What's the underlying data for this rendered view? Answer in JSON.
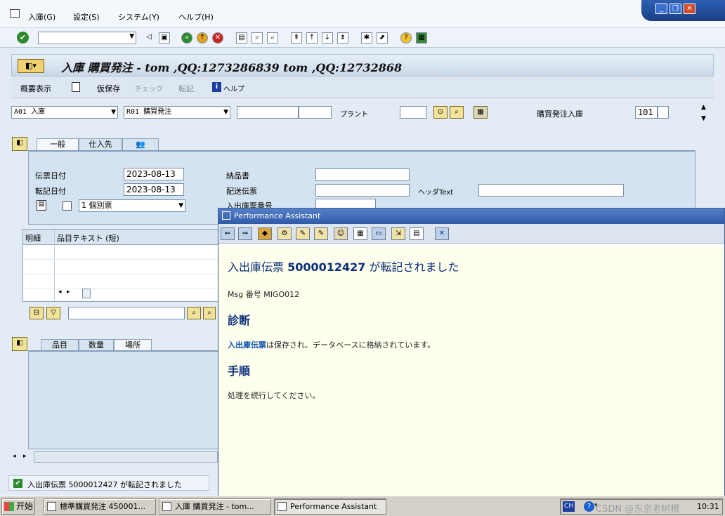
{
  "menu": {
    "items": [
      "入庫(G)",
      "設定(S)",
      "システム(Y)",
      "ヘルプ(H)"
    ]
  },
  "screen": {
    "title": "入庫 購買発注 - tom ,QQ:1273286839 tom ,QQ:12732868"
  },
  "appbar": {
    "overview": "概要表示",
    "hold": "仮保存",
    "check": "チェック",
    "post": "転記",
    "help": "ヘルプ"
  },
  "header": {
    "transaction": "A01 入庫",
    "reference": "R01 購買発注",
    "plant_label": "プラント",
    "gr_label": "購買発注入庫",
    "movement_type": "101"
  },
  "tabs": {
    "general": "一般",
    "vendor": "仕入先"
  },
  "general": {
    "doc_date_label": "伝票日付",
    "doc_date": "2023-08-13",
    "post_date_label": "転記日付",
    "post_date": "2023-08-13",
    "print_option": "1 個別票",
    "delivery_note_label": "納品書",
    "bill_of_lading_label": "配送伝票",
    "gr_slip_label": "入出庫票番号",
    "header_text_label": "ヘッダText"
  },
  "items_table": {
    "columns": [
      "明細",
      "品目テキスト (短)"
    ]
  },
  "detail_tabs": [
    "品目",
    "数量",
    "場所"
  ],
  "status": {
    "message": "入出庫伝票 5000012427 が転記されました"
  },
  "performance_assistant": {
    "title": "Performance Assistant",
    "heading_prefix": "入出庫伝票 ",
    "doc_number": "5000012427",
    "heading_suffix": " が転記されました",
    "msg_no": "Msg 番号  MIGO012",
    "diagnosis_title": "診断",
    "diagnosis_link": "入出庫伝票",
    "diagnosis_text": "は保存され、データベースに格納されています。",
    "procedure_title": "手順",
    "procedure_text": "処理を続行してください。"
  },
  "taskbar": {
    "start": "开始",
    "tasks": [
      "標準購買発注 450001...",
      "入庫 購買発注 - tom...",
      "Performance Assistant"
    ],
    "ime": "CH",
    "time": "10:31",
    "watermark": "CSDN @东京老树根"
  }
}
